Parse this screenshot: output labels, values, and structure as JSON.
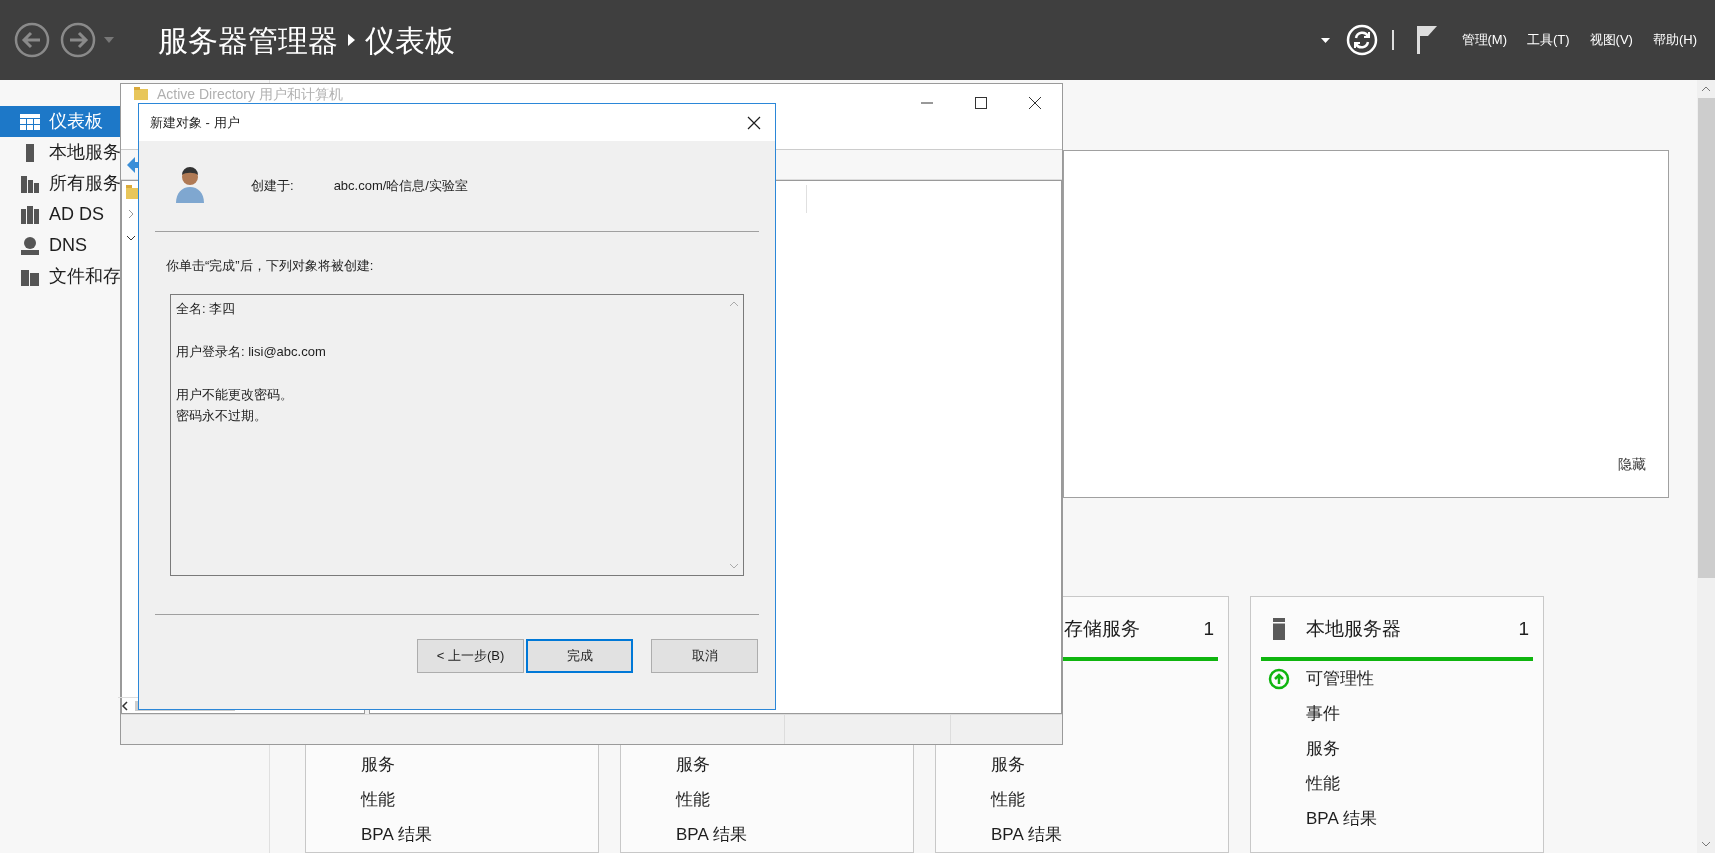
{
  "top_bar": {
    "title": "服务器管理器",
    "page": "仪表板",
    "menu": [
      "管理(M)",
      "工具(T)",
      "视图(V)",
      "帮助(H)"
    ]
  },
  "sidebar": {
    "items": [
      {
        "label": "仪表板",
        "kind": "dashboard",
        "selected": true
      },
      {
        "label": "本地服务",
        "kind": "server",
        "selected": false
      },
      {
        "label": "所有服务",
        "kind": "servers",
        "selected": false
      },
      {
        "label": "AD DS",
        "kind": "adds",
        "selected": false
      },
      {
        "label": "DNS",
        "kind": "dns",
        "selected": false
      },
      {
        "label": "文件和存",
        "kind": "files",
        "selected": false
      }
    ]
  },
  "welcome_panel": {
    "hide_link": "隐藏"
  },
  "tiles": [
    {
      "items": [
        {
          "label": "服务"
        },
        {
          "label": "性能"
        },
        {
          "label": "BPA 结果"
        }
      ]
    },
    {
      "items": [
        {
          "label": "服务"
        },
        {
          "label": "性能"
        },
        {
          "label": "BPA 结果"
        }
      ]
    },
    {
      "title": "存储服务",
      "count": "1",
      "items": [
        {
          "label": "服务"
        },
        {
          "label": "性能"
        },
        {
          "label": "BPA 结果"
        }
      ]
    },
    {
      "title": "本地服务器",
      "count": "1",
      "items": [
        {
          "label": "可管理性",
          "healthy": true
        },
        {
          "label": "事件"
        },
        {
          "label": "服务"
        },
        {
          "label": "性能"
        },
        {
          "label": "BPA 结果"
        }
      ]
    }
  ],
  "ad_window": {
    "title": "Active Directory 用户和计算机"
  },
  "dialog": {
    "title": "新建对象 - 用户",
    "created_in_label": "创建于:",
    "created_in_value": "abc.com/哈信息/实验室",
    "intro": "你单击“完成”后，下列对象将被创建:",
    "summary": [
      [
        "全名: 李四"
      ],
      [
        "用户登录名: lisi@abc.com"
      ],
      [
        "用户不能更改密码。",
        "密码永不过期。"
      ]
    ],
    "buttons": [
      {
        "label": "< 上一步(B)",
        "focused": false
      },
      {
        "label": "完成",
        "focused": true
      },
      {
        "label": "取消",
        "focused": false
      }
    ]
  }
}
